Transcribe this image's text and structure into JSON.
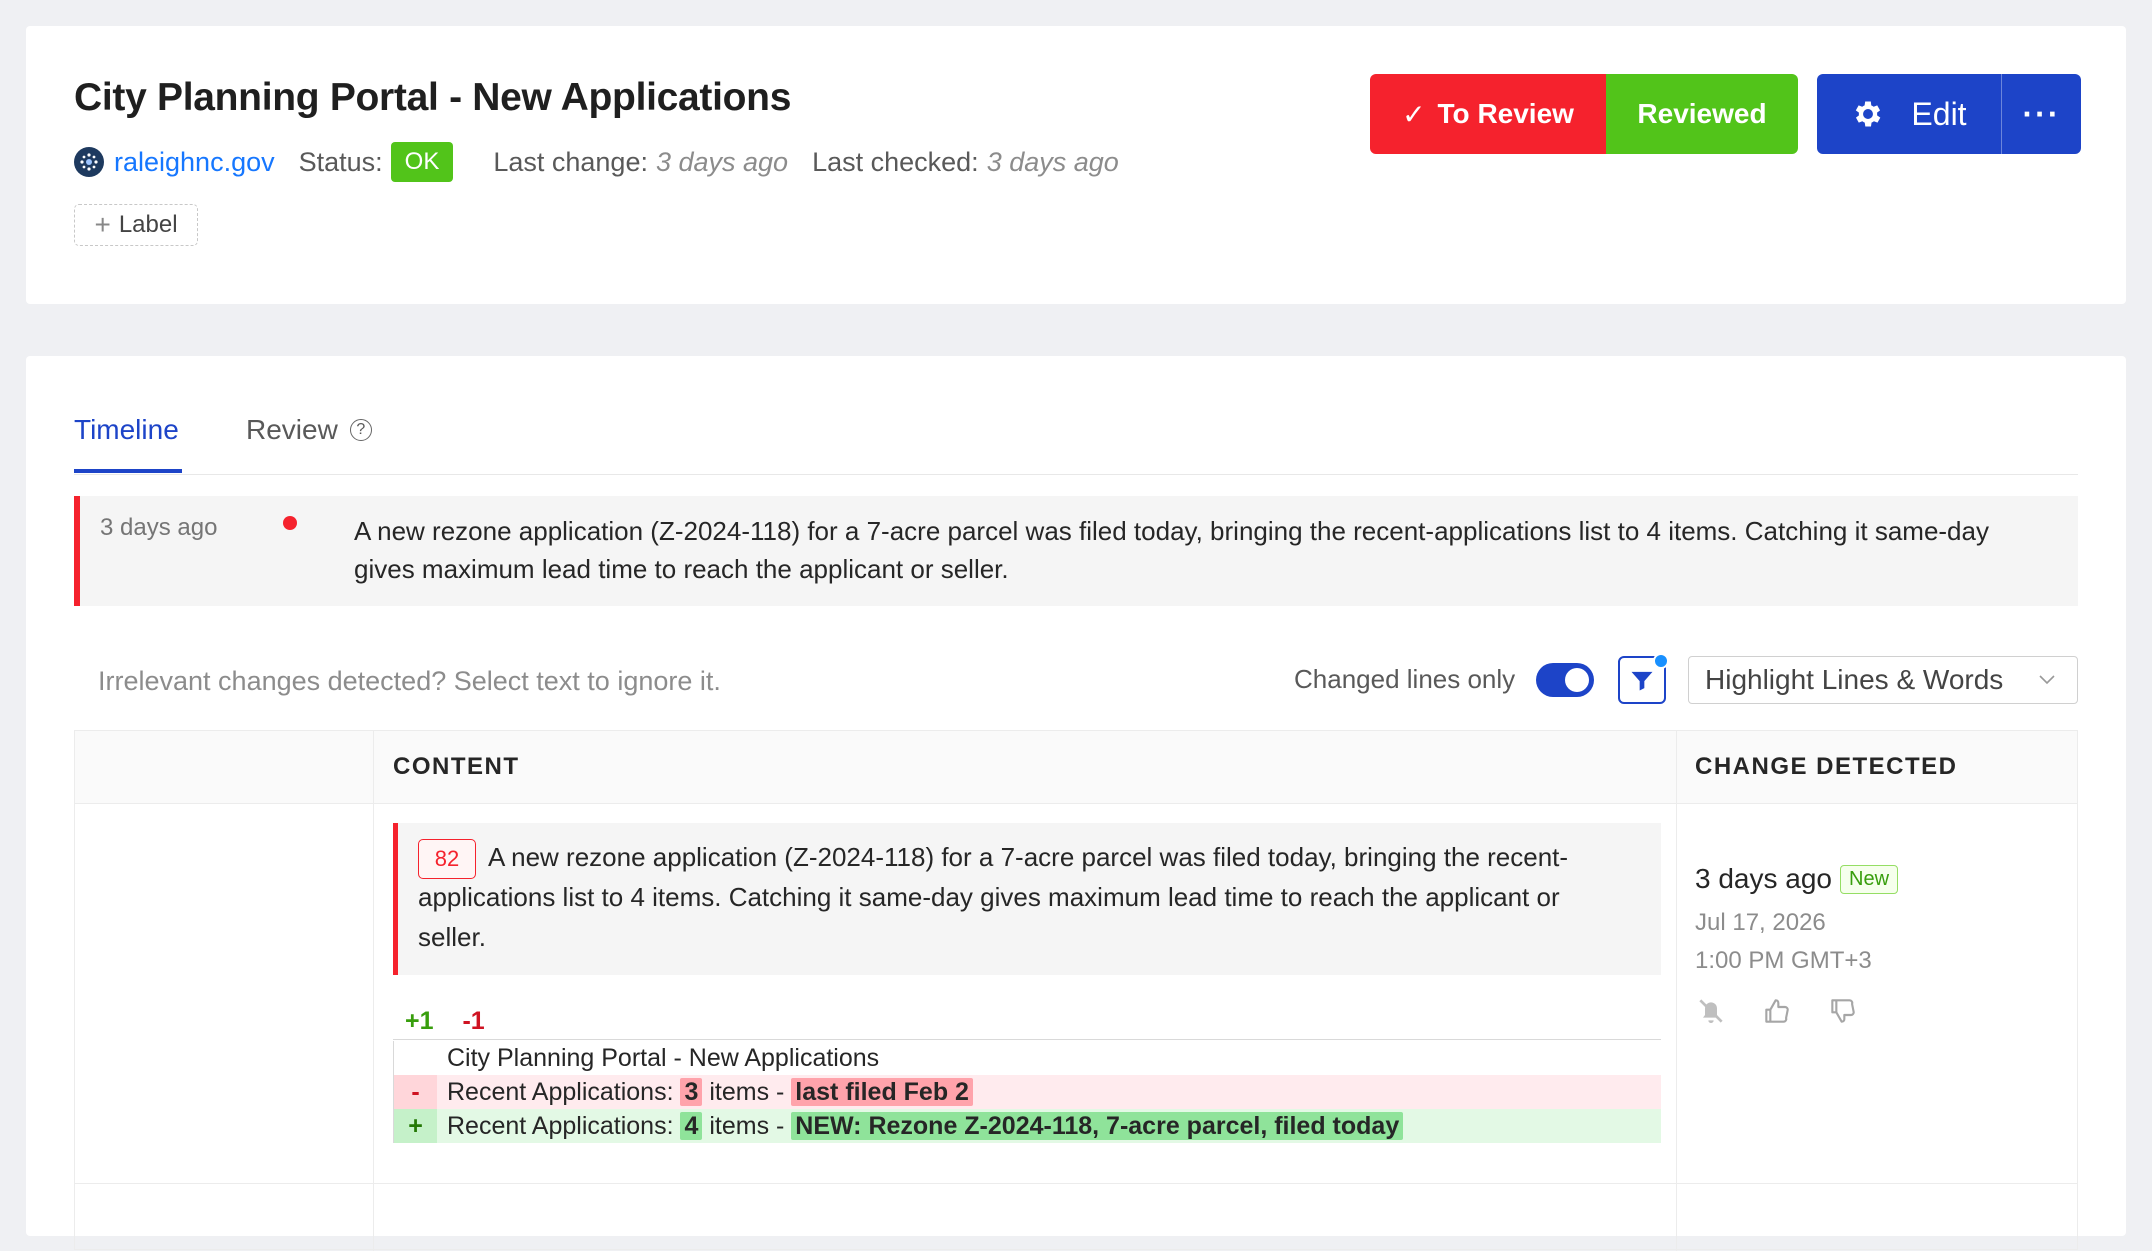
{
  "header": {
    "title": "City Planning Portal - New Applications",
    "site": "raleighnc.gov",
    "status_label": "Status:",
    "status_value": "OK",
    "last_change_label": "Last change:",
    "last_change_value": "3 days ago",
    "last_checked_label": "Last checked:",
    "last_checked_value": "3 days ago",
    "label_button": "Label",
    "to_review_label": "To Review",
    "reviewed_label": "Reviewed",
    "edit_label": "Edit",
    "more_label": "···"
  },
  "tabs": [
    {
      "label": "Timeline",
      "active": true
    },
    {
      "label": "Review",
      "active": false
    }
  ],
  "summary": {
    "time": "3 days ago",
    "text": "A new rezone application (Z-2024-118) for a 7-acre parcel was filed today, bringing the recent-applications list to 4 items. Catching it same-day gives maximum lead time to reach the applicant or seller."
  },
  "toolbar": {
    "ignore_hint": "Irrelevant changes detected? Select text to ignore it.",
    "changed_lines_label": "Changed lines only",
    "changed_lines_on": true,
    "highlight_mode": "Highlight Lines & Words"
  },
  "table": {
    "headers": [
      "CONTENT",
      "CHANGE DETECTED"
    ],
    "row": {
      "score": "82",
      "text": "A new rezone application (Z-2024-118) for a 7-acre parcel was filed today, bringing the recent-applications list to 4 items. Catching it same-day gives maximum lead time to reach the applicant or seller.",
      "added_count": "+1",
      "removed_count": "-1",
      "diff": {
        "context": "City Planning Portal - New Applications",
        "removed": {
          "sign": "-",
          "prefix": "Recent Applications: ",
          "num": "3",
          "mid": " items - ",
          "highlight": "last filed Feb 2"
        },
        "added": {
          "sign": "+",
          "prefix": "Recent Applications: ",
          "num": "4",
          "mid": " items - ",
          "highlight": "NEW: Rezone Z-2024-118, 7-acre parcel, filed today"
        }
      },
      "detected_ago": "3 days ago",
      "new_badge": "New",
      "detected_date": "Jul 17, 2026",
      "detected_time": "1:00 PM GMT+3"
    }
  },
  "colors": {
    "accent": "#1d44c8",
    "danger": "#f5222d",
    "success": "#52c41a",
    "link": "#1677ff"
  },
  "icons": [
    "site-favicon-icon",
    "check-icon",
    "gear-icon",
    "help-circle-icon",
    "filter-icon",
    "chevron-down-icon",
    "bell-off-icon",
    "thumbs-up-icon",
    "thumbs-down-icon",
    "plus-icon"
  ]
}
